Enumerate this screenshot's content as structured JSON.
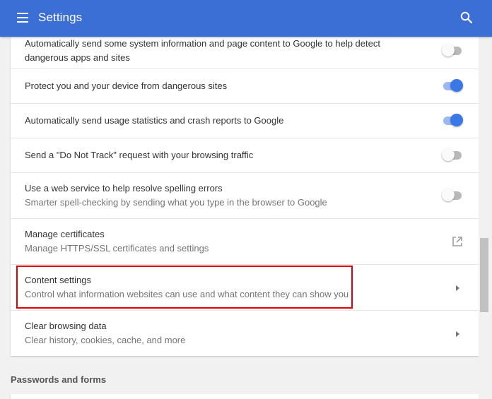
{
  "header": {
    "title": "Settings"
  },
  "rows": [
    {
      "label": "Automatically send some system information and page content to Google to help detect",
      "label2": "dangerous apps and sites",
      "control": "toggle",
      "on": false
    },
    {
      "label": "Protect you and your device from dangerous sites",
      "control": "toggle",
      "on": true
    },
    {
      "label": "Automatically send usage statistics and crash reports to Google",
      "control": "toggle",
      "on": true
    },
    {
      "label": "Send a \"Do Not Track\" request with your browsing traffic",
      "control": "toggle",
      "on": false
    },
    {
      "label": "Use a web service to help resolve spelling errors",
      "sublabel": "Smarter spell-checking by sending what you type in the browser to Google",
      "control": "toggle",
      "on": false
    },
    {
      "label": "Manage certificates",
      "sublabel": "Manage HTTPS/SSL certificates and settings",
      "control": "external-link-icon"
    },
    {
      "label": "Content settings",
      "sublabel": "Control what information websites can use and what content they can show you",
      "control": "arrow-right-icon",
      "highlighted": true
    },
    {
      "label": "Clear browsing data",
      "sublabel": "Clear history, cookies, cache, and more",
      "control": "arrow-right-icon"
    }
  ],
  "next_section": {
    "title": "Passwords and forms"
  },
  "colors": {
    "header": "#3b6fd6",
    "toggle_on": "#3b78e7",
    "highlight": "#e00000"
  }
}
